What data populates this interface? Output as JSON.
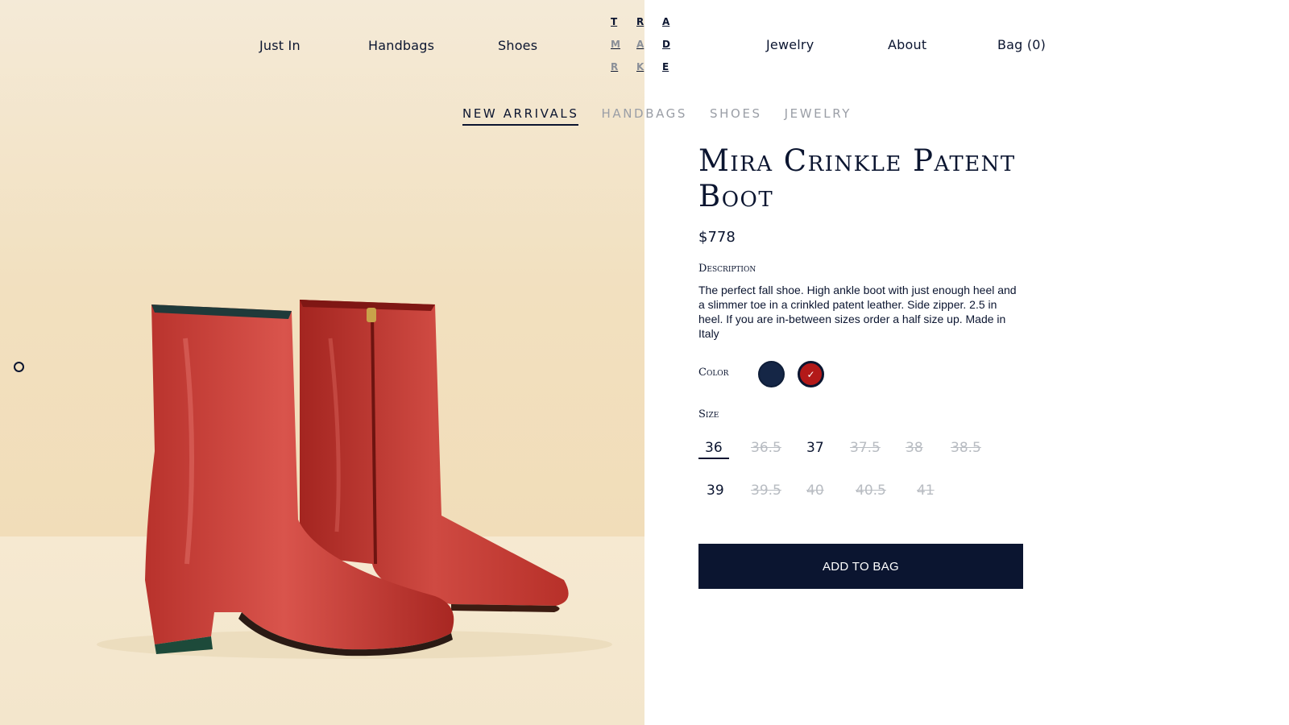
{
  "nav": {
    "left": [
      "Just In",
      "Handbags",
      "Shoes"
    ],
    "right": [
      "Jewelry",
      "About",
      "Bag (0)"
    ]
  },
  "logo": {
    "letters": [
      "T",
      "R",
      "A",
      "M",
      "A",
      "D",
      "R",
      "K",
      "E"
    ]
  },
  "tabs": [
    {
      "label": "NEW ARRIVALS",
      "active": true
    },
    {
      "label": "HANDBAGS",
      "active": false
    },
    {
      "label": "SHOES",
      "active": false
    },
    {
      "label": "JEWELRY",
      "active": false
    }
  ],
  "product": {
    "title": "Mira Crinkle Patent Boot",
    "price": "$778",
    "description_label": "Description",
    "description": "The perfect fall shoe. High ankle boot with just enough heel and a slimmer toe in a crinkled patent leather. Side zipper. 2.5 in heel. If you are in-between sizes order a half size up. Made in Italy",
    "color_label": "Color",
    "colors": [
      {
        "name": "navy",
        "hex": "#152646",
        "selected": false
      },
      {
        "name": "red",
        "hex": "#b31919",
        "selected": true
      }
    ],
    "size_label": "Size",
    "sizes": [
      {
        "label": "36",
        "available": true,
        "selected": true
      },
      {
        "label": "36.5",
        "available": false
      },
      {
        "label": "37",
        "available": true
      },
      {
        "label": "37.5",
        "available": false
      },
      {
        "label": "38",
        "available": false
      },
      {
        "label": "38.5",
        "available": false
      },
      {
        "label": "39",
        "available": true
      },
      {
        "label": "39.5",
        "available": false
      },
      {
        "label": "40",
        "available": false
      },
      {
        "label": "40.5",
        "available": false
      },
      {
        "label": "41",
        "available": false
      }
    ],
    "add_button": "ADD TO BAG"
  },
  "colors": {
    "navy_text": "#0b1530",
    "muted_text": "#9a9ea6",
    "sold_out": "#b8bcc2",
    "background_beige": "#f2e0bf"
  }
}
